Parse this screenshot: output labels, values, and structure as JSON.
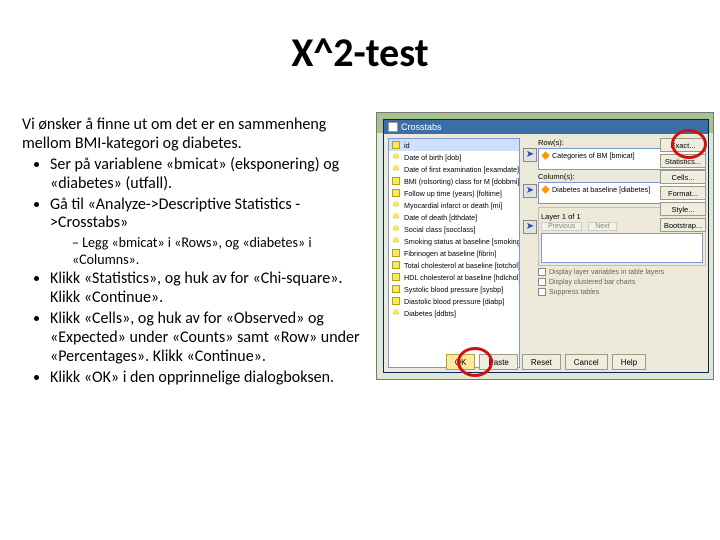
{
  "title": "X^2-test",
  "intro": "Vi ønsker å finne ut om det er en sammenheng mellom BMI-kategori og diabetes.",
  "bullets": [
    "Ser på variablene «bmicat» (eksponering) og «diabetes» (utfall).",
    "Gå til «Analyze->Descriptive Statistics ->Crosstabs»"
  ],
  "subbullet": "Legg «bmicat» i «Rows», og «diabetes» i «Columns».",
  "bullets2": [
    "Klikk «Statistics», og huk av for «Chi-square». Klikk «Continue».",
    "Klikk «Cells», og huk av for «Observed» og «Expected» under «Counts» samt «Row» under «Percentages». Klikk «Continue».",
    "Klikk «OK» i den opprinnelige dialogboksen."
  ],
  "dialog": {
    "title": "Crosstabs",
    "vars": [
      {
        "icon": "s",
        "label": "id",
        "sel": true
      },
      {
        "icon": "n",
        "label": "Date of birth [dob]"
      },
      {
        "icon": "n",
        "label": "Date of first examination [examdate]"
      },
      {
        "icon": "s",
        "label": "BMI (rolsorting) class for M [dobbmi]"
      },
      {
        "icon": "s",
        "label": "Follow up time (years) [foltime]"
      },
      {
        "icon": "n",
        "label": "Myocardial infarct or death [mi]"
      },
      {
        "icon": "n",
        "label": "Date of death [dthdate]"
      },
      {
        "icon": "n",
        "label": "Social class [socclass]"
      },
      {
        "icon": "n",
        "label": "Smoking status at baseline [smoking]"
      },
      {
        "icon": "s",
        "label": "Fibrinogen at baseline [fibrin]"
      },
      {
        "icon": "s",
        "label": "Total cholesterol at baseline [totchol]"
      },
      {
        "icon": "s",
        "label": "HDL cholesterol at baseline [hdlchol]"
      },
      {
        "icon": "s",
        "label": "Systolic blood pressure [sysbp]"
      },
      {
        "icon": "s",
        "label": "Diastolic blood pressure [diabp]"
      },
      {
        "icon": "n",
        "label": "Diabetes [ddbts]"
      }
    ],
    "rows_label": "Row(s):",
    "rows_item": "Categories of BM [bmicat]",
    "cols_label": "Column(s):",
    "cols_item": "Diabetes at baseline [diabetes]",
    "layer_label": "Layer 1 of 1",
    "layer_prev": "Previous",
    "layer_next": "Next",
    "chk1": "Display layer variables in table layers",
    "chk2": "Display clustered bar charts",
    "chk3": "Suppress tables",
    "side": [
      "Exact...",
      "Statistics...",
      "Cells...",
      "Format...",
      "Style...",
      "Bootstrap..."
    ],
    "bottom": {
      "ok": "OK",
      "paste": "Paste",
      "reset": "Reset",
      "cancel": "Cancel",
      "help": "Help"
    }
  }
}
